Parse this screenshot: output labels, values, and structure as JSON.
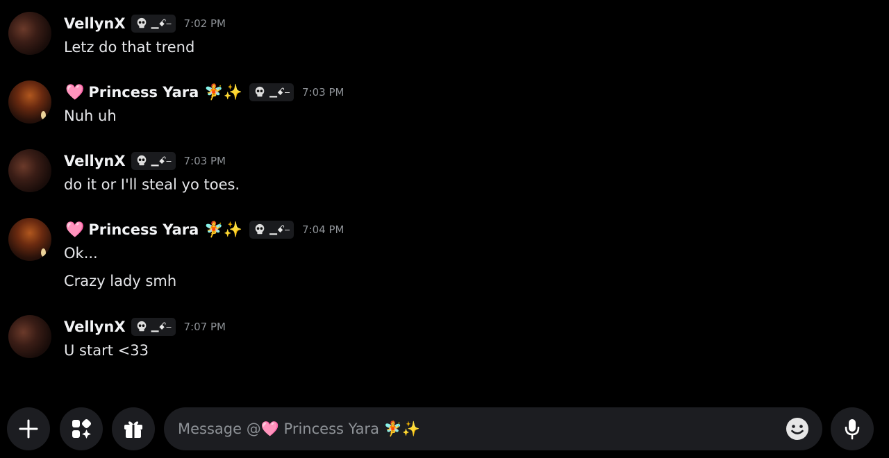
{
  "messages": [
    {
      "author": "VellynX",
      "author_prefix": "",
      "author_suffix": "",
      "tag": "▁ꗃ⎯",
      "time": "7:02 PM",
      "lines": [
        "Letz do that trend"
      ],
      "avatar": "v"
    },
    {
      "author": "Princess Yara",
      "author_prefix": "🩷",
      "author_suffix": "🧚✨",
      "tag": "▁ꗃ⎯",
      "time": "7:03 PM",
      "lines": [
        "Nuh uh"
      ],
      "avatar": "p"
    },
    {
      "author": "VellynX",
      "author_prefix": "",
      "author_suffix": "",
      "tag": "▁ꗃ⎯",
      "time": "7:03 PM",
      "lines": [
        "do it or I'll steal yo toes."
      ],
      "avatar": "v"
    },
    {
      "author": "Princess Yara",
      "author_prefix": "🩷",
      "author_suffix": "🧚✨",
      "tag": "▁ꗃ⎯",
      "time": "7:04 PM",
      "lines": [
        "Ok...",
        "Crazy lady smh"
      ],
      "avatar": "p"
    },
    {
      "author": "VellynX",
      "author_prefix": "",
      "author_suffix": "",
      "tag": "▁ꗃ⎯",
      "time": "7:07 PM",
      "lines": [
        "U start <33"
      ],
      "avatar": "v"
    }
  ],
  "composer": {
    "placeholder": "Message @🩷 Princess Yara 🧚✨",
    "buttons": [
      "plus-icon",
      "apps-icon",
      "gift-icon",
      "emoji-icon",
      "microphone-icon"
    ]
  },
  "colors": {
    "background": "#000000",
    "input": "#1c1d21",
    "timestamp": "#8e9297"
  }
}
